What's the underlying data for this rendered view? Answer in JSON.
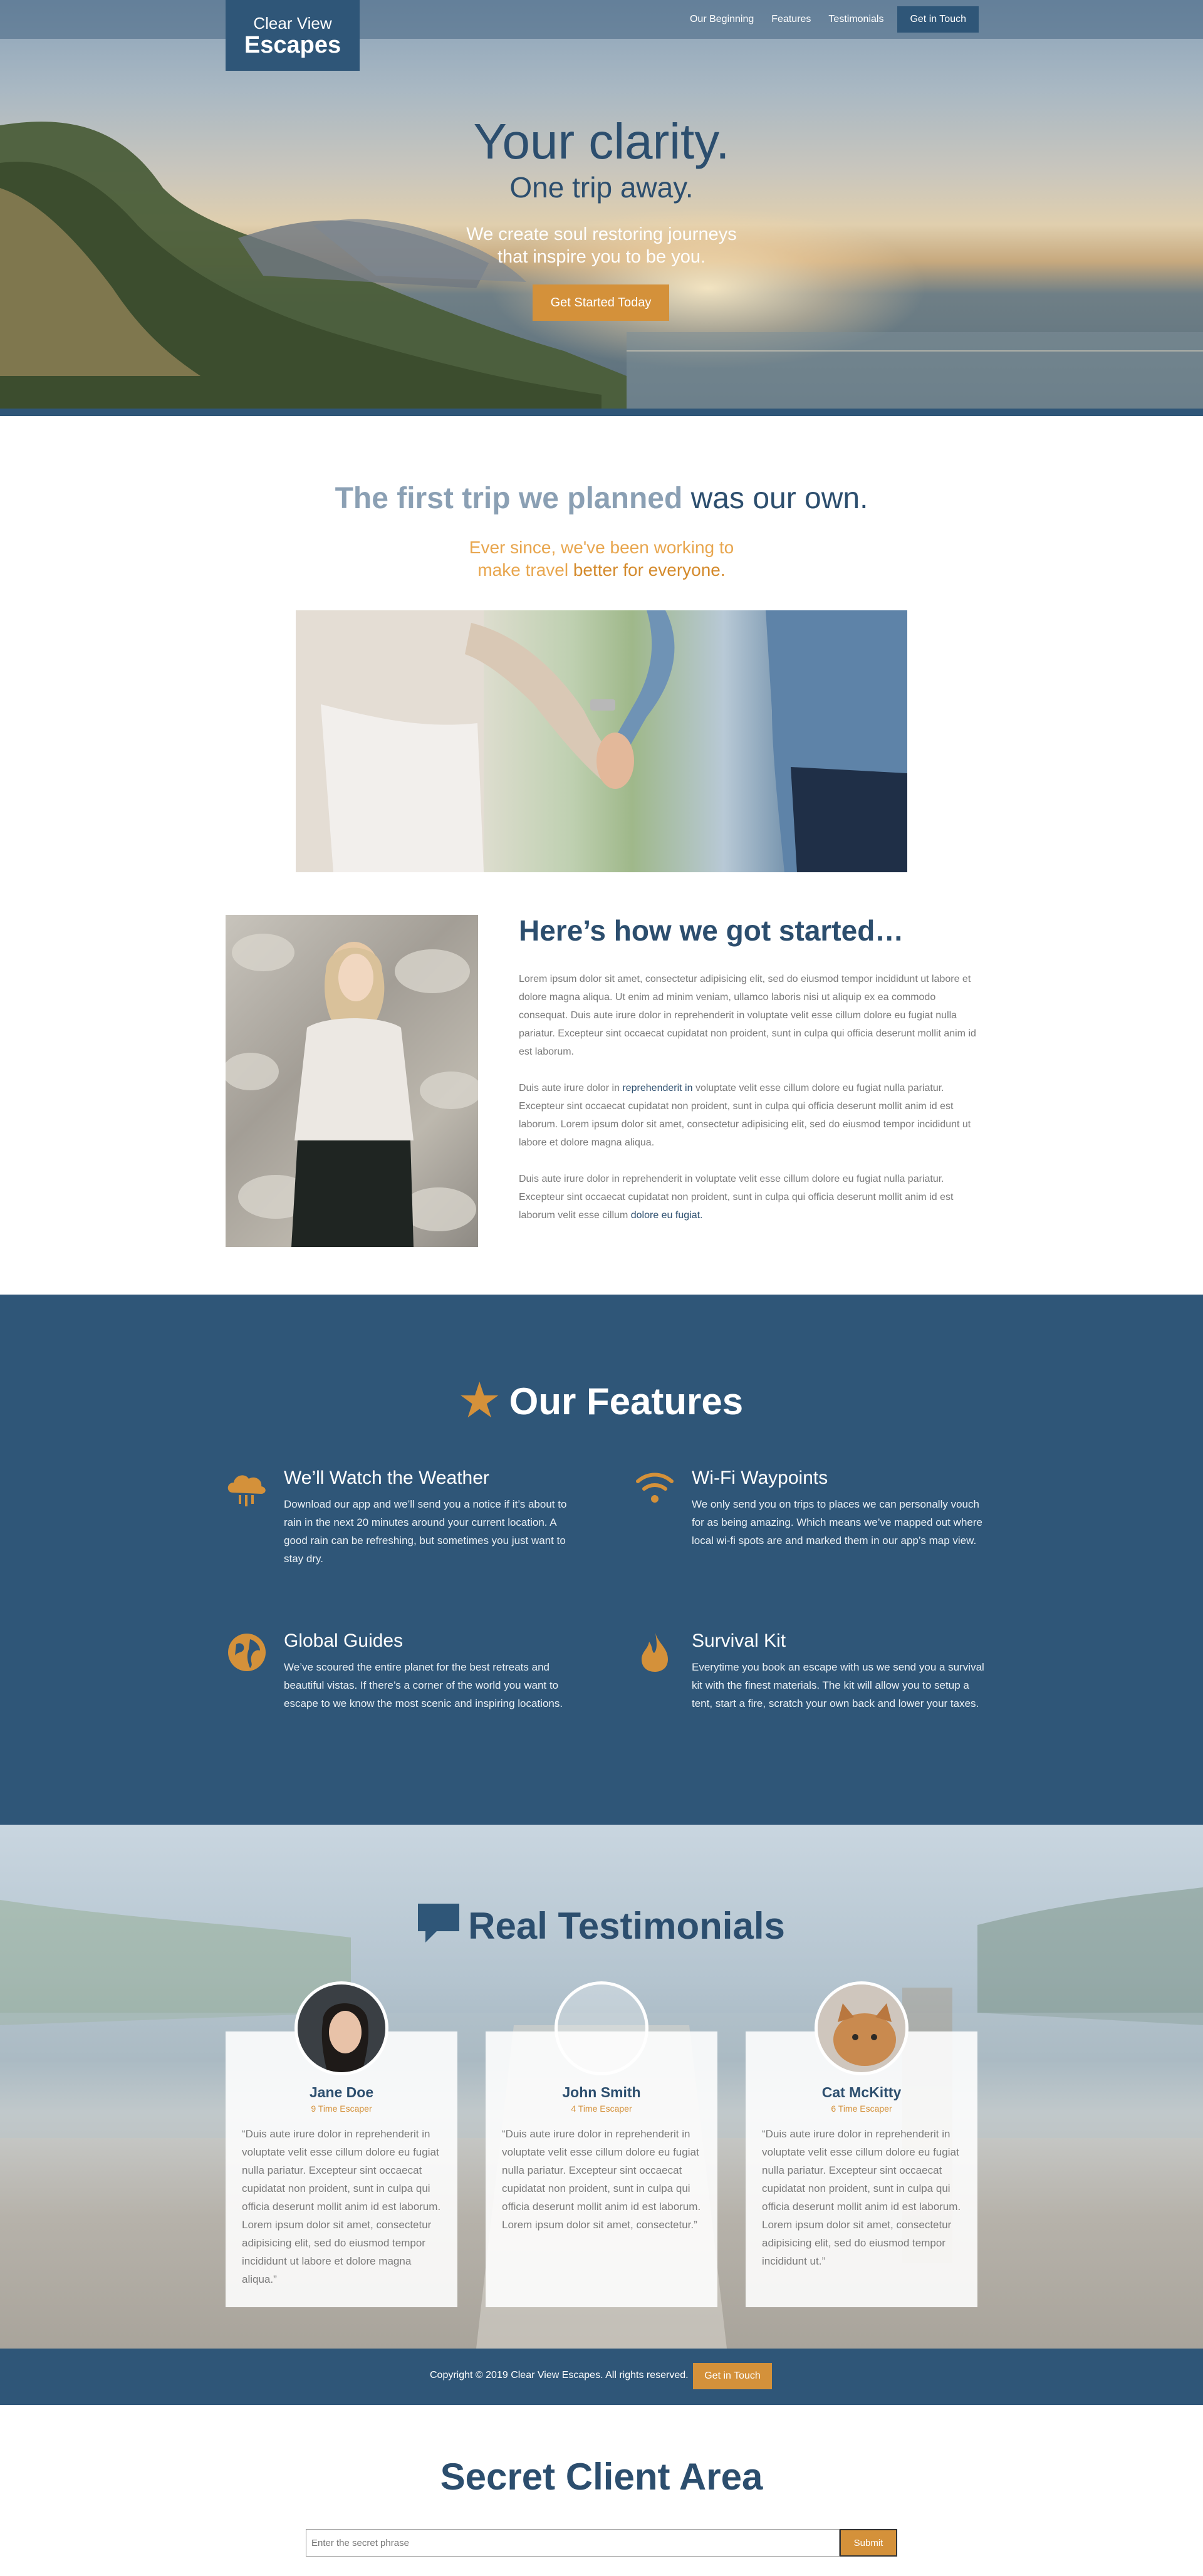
{
  "nav": {
    "logo_line1": "Clear View",
    "logo_line2": "Escapes",
    "links": [
      "Our Beginning",
      "Features",
      "Testimonials"
    ],
    "cta": "Get in Touch"
  },
  "hero": {
    "title": "Your clarity.",
    "subtitle": "One trip away.",
    "desc_line1": "We create soul restoring journeys",
    "desc_line2": "that inspire you to be you.",
    "cta": "Get Started Today"
  },
  "story": {
    "title_light": "The first trip we planned ",
    "title_bold": "was our own.",
    "sub_line1": "Ever since, we've been working to",
    "sub_line2_light": "make travel ",
    "sub_line2_bold": "better for everyone."
  },
  "started": {
    "title": "Here’s how we got started…",
    "p1": "Lorem ipsum dolor sit amet, consectetur adipisicing elit, sed do eiusmod tempor incididunt ut labore et dolore magna aliqua. Ut enim ad minim veniam, ullamco laboris nisi ut aliquip ex ea commodo consequat. Duis aute irure dolor in reprehenderit in voluptate velit esse cillum dolore eu fugiat nulla pariatur. Excepteur sint occaecat cupidatat non proident, sunt in culpa qui officia deserunt mollit anim id est laborum.",
    "p2_a": "Duis aute irure dolor in ",
    "p2_b": "reprehenderit in",
    "p2_c": " voluptate velit esse cillum dolore eu fugiat nulla pariatur. Excepteur sint occaecat cupidatat non proident, sunt in culpa qui officia deserunt mollit anim id est laborum. Lorem ipsum dolor sit amet, consectetur adipisicing elit, sed do eiusmod tempor incididunt ut labore et dolore magna aliqua.",
    "p3_a": "Duis aute irure dolor in reprehenderit in voluptate velit esse cillum dolore eu fugiat nulla pariatur. Excepteur sint occaecat cupidatat non proident, sunt in culpa qui officia deserunt mollit anim id est laborum velit esse cillum ",
    "p3_b": "dolore eu fugiat."
  },
  "features": {
    "head_light": "Our ",
    "head_bold": "Features",
    "items": [
      {
        "title": "We’ll Watch the Weather",
        "icon": "cloud-rain-icon",
        "body": "Download our app and we’ll send you a notice if it’s about to rain in the next 20 minutes around your current location. A good rain can be refreshing, but sometimes you just want to stay dry."
      },
      {
        "title": "Wi-Fi Waypoints",
        "icon": "wifi-icon",
        "body": "We only send you on trips to places we can personally vouch for as being amazing. Which means we’ve mapped out where local wi-fi spots are and marked them in our app’s map view."
      },
      {
        "title": "Global Guides",
        "icon": "globe-icon",
        "body": "We’ve scoured the entire planet for the best retreats and beautiful vistas. If there’s a corner of the world you want to escape to we know the most scenic and inspiring locations."
      },
      {
        "title": "Survival Kit",
        "icon": "fire-icon",
        "body": "Everytime you book an escape with us we send you a survival kit with the finest materials. The kit will allow you to setup a tent, start a fire, scratch your own back and lower your taxes."
      }
    ]
  },
  "testimonials": {
    "head_light": "Real ",
    "head_bold": "Testimonials",
    "cards": [
      {
        "name": "Jane Doe",
        "role": "9 Time Escaper",
        "quote": "“Duis aute irure dolor in reprehenderit in voluptate velit esse cillum dolore eu fugiat nulla pariatur. Excepteur sint occaecat cupidatat non proident, sunt in culpa qui officia deserunt mollit anim id est laborum. Lorem ipsum dolor sit amet, consectetur adipisicing elit, sed do eiusmod tempor incididunt ut labore et dolore magna aliqua.”"
      },
      {
        "name": "John Smith",
        "role": "4 Time Escaper",
        "quote": "“Duis aute irure dolor in reprehenderit in voluptate velit esse cillum dolore eu fugiat nulla pariatur. Excepteur sint occaecat cupidatat non proident, sunt in culpa qui officia deserunt mollit anim id est laborum. Lorem ipsum dolor sit amet, consectetur.”"
      },
      {
        "name": "Cat McKitty",
        "role": "6 Time Escaper",
        "quote": "“Duis aute irure dolor in reprehenderit in voluptate velit esse cillum dolore eu fugiat nulla pariatur. Excepteur sint occaecat cupidatat non proident, sunt in culpa qui officia deserunt mollit anim id est laborum. Lorem ipsum dolor sit amet, consectetur adipisicing elit, sed do eiusmod tempor incididunt ut.”"
      }
    ]
  },
  "footer": {
    "copyright": "Copyright © 2019 Clear View Escapes. All rights reserved.",
    "cta": "Get in Touch"
  },
  "secret": {
    "title": "Secret Client Area",
    "placeholder": "Enter the secret phrase",
    "submit": "Submit"
  },
  "colors": {
    "brand_blue": "#2f5678",
    "accent_orange": "#d4913a"
  }
}
